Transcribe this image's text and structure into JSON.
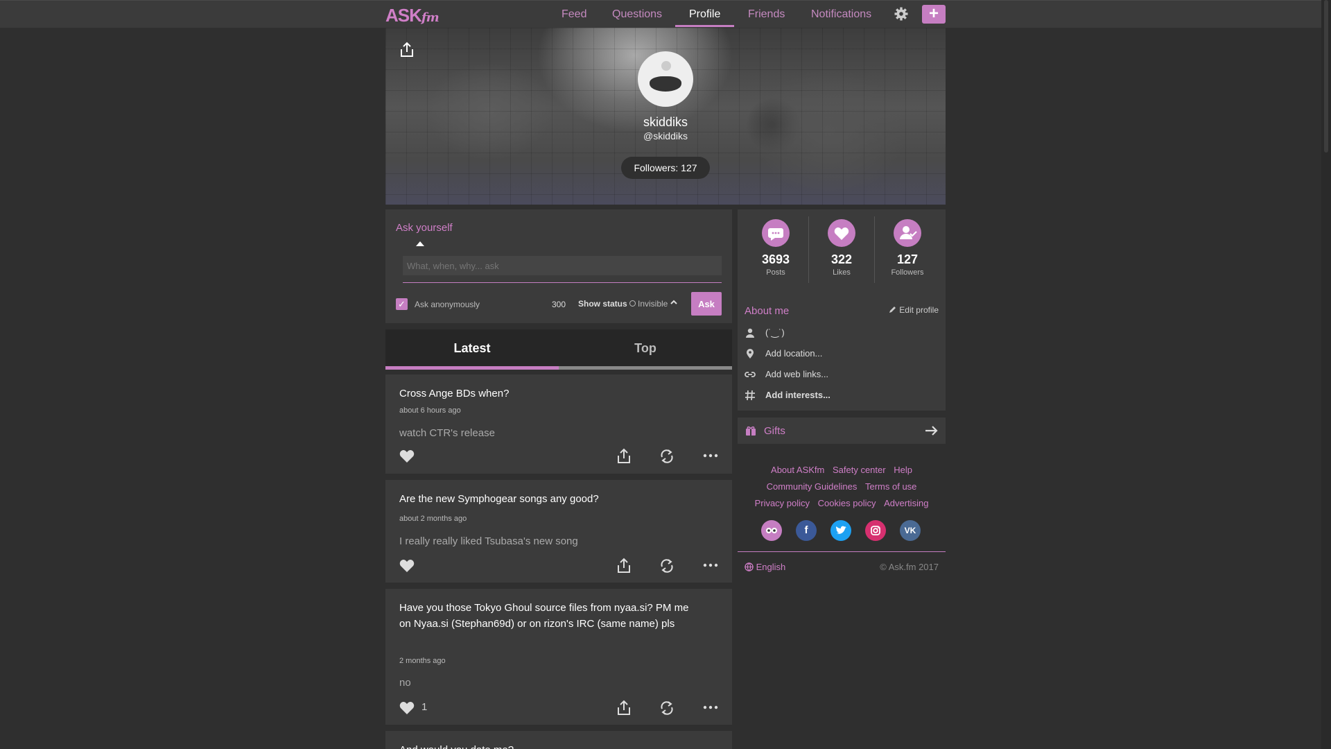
{
  "nav": {
    "logo": "ASK",
    "logo_suffix": "fm",
    "items": [
      {
        "label": "Feed"
      },
      {
        "label": "Questions"
      },
      {
        "label": "Profile"
      },
      {
        "label": "Friends"
      },
      {
        "label": "Notifications"
      }
    ],
    "active": "Profile",
    "plus_label": "+"
  },
  "profile": {
    "name": "skiddiks",
    "handle": "@skiddiks",
    "followers_pill": "Followers: 127"
  },
  "ask": {
    "title": "Ask yourself",
    "placeholder": "What, when, why... ask",
    "anonymous_label": "Ask anonymously",
    "anonymous_checked": true,
    "char_count": "300",
    "show_status_label": "Show status",
    "status_value": "Invisible",
    "button_label": "Ask"
  },
  "tabs": [
    {
      "label": "Latest"
    },
    {
      "label": "Top"
    }
  ],
  "posts": [
    {
      "question": "Cross Ange BDs when?",
      "time": "about 6 hours ago",
      "answer": "watch CTR's release",
      "likes": ""
    },
    {
      "question": "Are the new Symphogear songs any good?",
      "time": "about 2 months ago",
      "answer": "I really really liked Tsubasa's new song",
      "likes": ""
    },
    {
      "question": "Have you those Tokyo Ghoul source files from nyaa.si? PM me on Nyaa.si (Stephan69d) or on rizon's IRC (same name) pls",
      "time": "2 months ago",
      "answer": "no",
      "likes": "1"
    },
    {
      "question": "And would you date me?",
      "time": "",
      "answer": "",
      "likes": ""
    }
  ],
  "stats": [
    {
      "value": "3693",
      "label": "Posts",
      "icon": "chat-bubble-icon"
    },
    {
      "value": "322",
      "label": "Likes",
      "icon": "heart-icon"
    },
    {
      "value": "127",
      "label": "Followers",
      "icon": "user-check-icon"
    }
  ],
  "about": {
    "title": "About me",
    "edit_label": "Edit profile",
    "bio": "(˙‿˙)",
    "location": "Add location...",
    "web_links": "Add web links...",
    "interests": "Add interests..."
  },
  "gifts": {
    "label": "Gifts"
  },
  "footer": {
    "links_row1": [
      "About ASKfm",
      "Safety center",
      "Help"
    ],
    "links_row2": [
      "Community Guidelines",
      "Terms of use"
    ],
    "links_row3": [
      "Privacy policy",
      "Cookies policy",
      "Advertising"
    ],
    "language": "English",
    "copyright": "© Ask.fm 2017"
  },
  "colors": {
    "accent": "#c67ec2",
    "background": "#2f2f2f",
    "panel": "#3b3b3b",
    "facebook": "#3b5998",
    "twitter": "#1da1f2",
    "instagram": "#d6306f",
    "vk": "#4a6a94"
  }
}
